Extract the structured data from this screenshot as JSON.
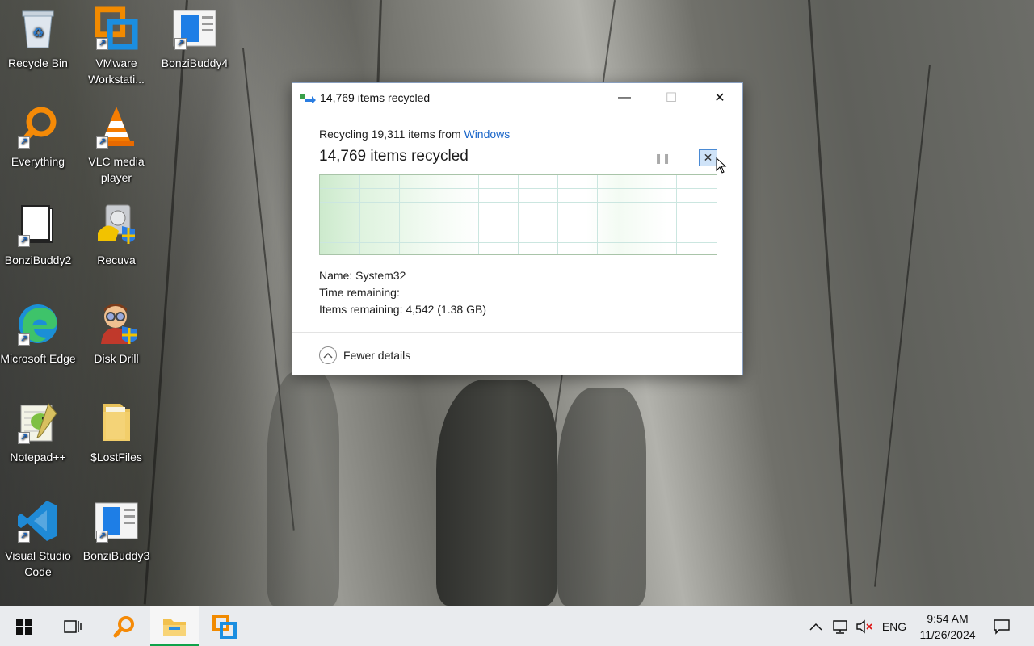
{
  "desktop": {
    "icons": [
      {
        "label": "Recycle Bin"
      },
      {
        "label": "VMware Workstati..."
      },
      {
        "label": "BonziBuddy4"
      },
      {
        "label": "Everything"
      },
      {
        "label": "VLC media player"
      },
      {
        "label": "BonziBuddy2"
      },
      {
        "label": "Recuva"
      },
      {
        "label": "Microsoft Edge"
      },
      {
        "label": "Disk Drill"
      },
      {
        "label": "Notepad++"
      },
      {
        "label": "$LostFiles"
      },
      {
        "label": "Visual Studio Code"
      },
      {
        "label": "BonziBuddy3"
      }
    ]
  },
  "dialog": {
    "title": "14,769 items recycled",
    "subline_prefix": "Recycling 19,311 items from ",
    "subline_link": "Windows",
    "headline": "14,769 items recycled",
    "pause_glyph": "❚❚",
    "cancel_glyph": "✕",
    "details": {
      "name_label": "Name:",
      "name_value": "System32",
      "time_label": "Time remaining:",
      "time_value": "",
      "items_label": "Items remaining:",
      "items_value": "4,542 (1.38 GB)"
    },
    "fewer_details": "Fewer details",
    "window_buttons": {
      "minimize": "—",
      "maximize": "☐",
      "close": "✕"
    }
  },
  "taskbar": {
    "language": "ENG",
    "time": "9:54 AM",
    "date": "11/26/2024"
  },
  "colors": {
    "accent": "#1a66c9",
    "graph_fill": "#cdeacd",
    "taskbar_active": "#0fa34b"
  }
}
